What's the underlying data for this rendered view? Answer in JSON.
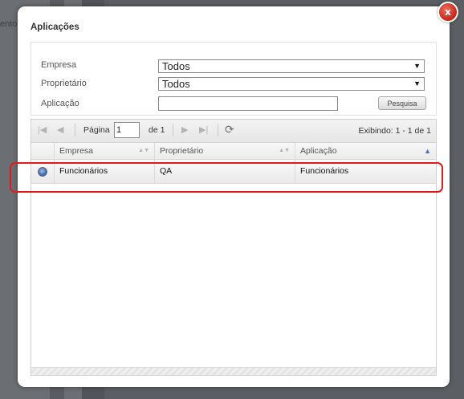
{
  "background": {
    "partial_text": "ento"
  },
  "dialog": {
    "title": "Aplicações",
    "close_label": "x"
  },
  "filters": {
    "empresa_label": "Empresa",
    "empresa_value": "Todos",
    "proprietario_label": "Proprietário",
    "proprietario_value": "Todos",
    "aplicacao_label": "Aplicação",
    "aplicacao_value": "",
    "search_button": "Pesquisa"
  },
  "pager": {
    "page_label": "Página",
    "page_value": "1",
    "of_label": "de 1",
    "status": "Exibindo: 1 - 1 de 1"
  },
  "columns": {
    "empresa": "Empresa",
    "proprietario": "Proprietário",
    "aplicacao": "Aplicação"
  },
  "rows": [
    {
      "empresa": "Funcionários",
      "proprietario": "QA",
      "aplicacao": "Funcionários",
      "selected": true
    }
  ],
  "colors": {
    "highlight": "#e11a1a",
    "close_button": "#c3261a",
    "overlay": "#5b5e63"
  }
}
